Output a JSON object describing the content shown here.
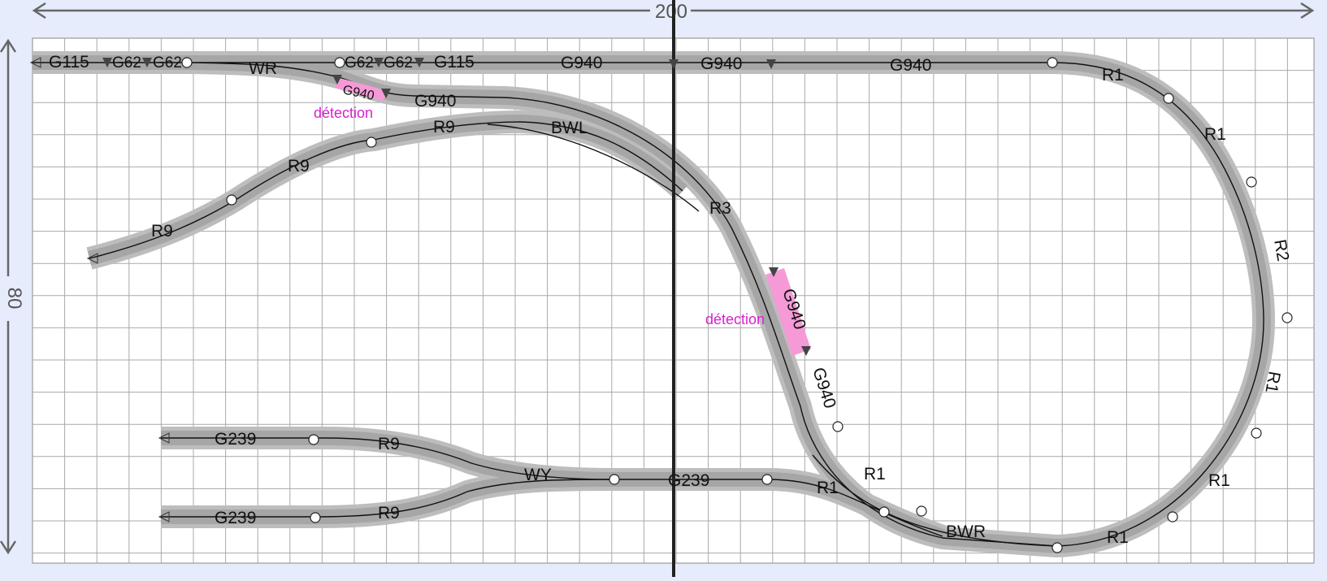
{
  "colors": {
    "background": "#e6ecfb",
    "board": "#ffffff",
    "grid": "#a9a9a9",
    "track_outer": "#bdbdbd",
    "track_inner": "#a6a6a6",
    "rail": "#111111",
    "detection_fill": "#f59ad6",
    "detection_text": "#d81fd0",
    "center_line": "#222222"
  },
  "dimensions": {
    "width_label": "200",
    "height_label": "80"
  },
  "detection_label": "détection",
  "pieces": {
    "g115_a": "G115",
    "g62_a": "G62",
    "g62_b": "G62",
    "wr": "WR",
    "g62_c": "G62",
    "g62_d": "G62",
    "g115_b": "G115",
    "g940_top_a": "G940",
    "g940_top_b": "G940",
    "g940_top_c": "G940",
    "g940_det_small": "G940",
    "g940_mid": "G940",
    "r9_top": "R9",
    "bwl": "BWL",
    "r9_mid": "R9",
    "r9_low": "R9",
    "r3": "R3",
    "g940_det_right": "G940",
    "g940_right": "G940",
    "r1_a": "R1",
    "r1_b": "R1",
    "r2": "R2",
    "r1_c": "R1",
    "r1_d": "R1",
    "r1_e": "R1",
    "bwr": "BWR",
    "r1_f": "R1",
    "r1_g": "R1",
    "g239_upper": "G239",
    "r9_upper": "R9",
    "wy": "WY",
    "g239_mid": "G239",
    "g239_lower": "G239",
    "r9_lower": "R9"
  }
}
